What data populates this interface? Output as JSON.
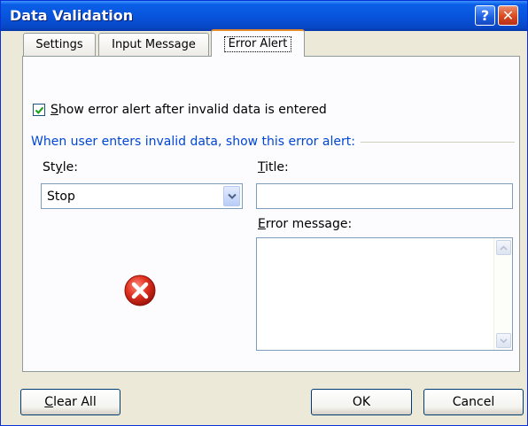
{
  "window": {
    "title": "Data Validation",
    "help_glyph": "?",
    "close_glyph": "✕"
  },
  "tabs": [
    {
      "label": "Settings"
    },
    {
      "label": "Input Message"
    },
    {
      "label": "Error Alert",
      "selected": true
    }
  ],
  "error_alert": {
    "show_alert": {
      "checked": true,
      "label_mnemonic": "S",
      "label_rest": "how error alert after invalid data is entered"
    },
    "group_label": "When user enters invalid data, show this error alert:",
    "style": {
      "label_pre": "St",
      "label_mnemonic": "y",
      "label_post": "le:",
      "value": "Stop"
    },
    "title": {
      "label_mnemonic": "T",
      "label_rest": "itle:",
      "value": ""
    },
    "error_message": {
      "label_mnemonic": "E",
      "label_rest": "rror message:",
      "value": ""
    },
    "icon": "stop-error-icon"
  },
  "buttons": {
    "clear_all": {
      "mnemonic": "C",
      "rest": "lear All"
    },
    "ok": "OK",
    "cancel": "Cancel"
  },
  "colors": {
    "title_bar": "#0855dd",
    "group_label": "#0046d5",
    "active_tab_accent": "#e68b2c",
    "stop_icon": "#d7261c"
  }
}
